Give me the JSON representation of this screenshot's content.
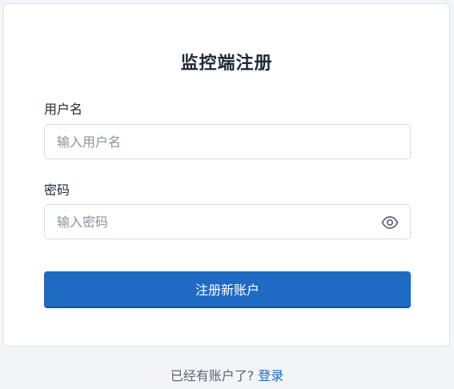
{
  "form": {
    "title": "监控端注册",
    "username_label": "用户名",
    "username_placeholder": "输入用户名",
    "username_value": "",
    "password_label": "密码",
    "password_placeholder": "输入密码",
    "password_value": "",
    "password_toggle_icon": "eye-icon",
    "submit_label": "注册新账户"
  },
  "footer": {
    "prompt": "已经有账户了?",
    "login_link": "登录"
  },
  "colors": {
    "accent": "#1f6ac3",
    "background": "#f2f4f8",
    "card": "#ffffff"
  }
}
